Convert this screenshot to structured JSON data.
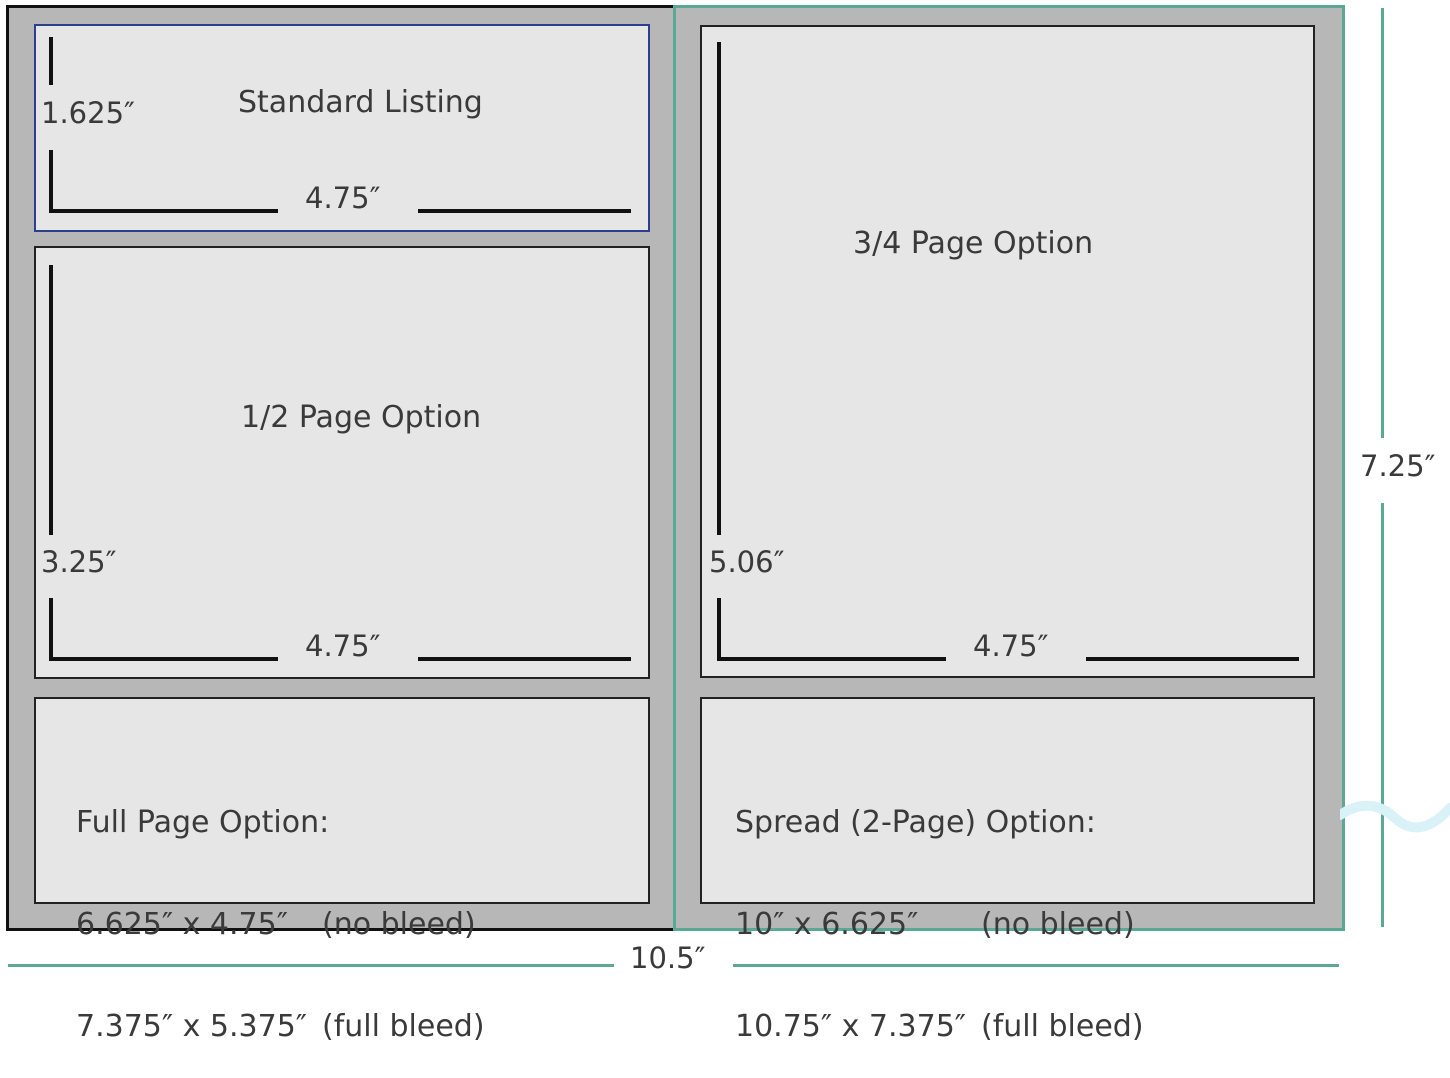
{
  "standard_listing": {
    "title": "Standard Listing",
    "height": "1.625″",
    "width": "4.75″"
  },
  "half_page": {
    "title": "1/2 Page Option",
    "height": "3.25″",
    "width": "4.75″"
  },
  "three_quarter_page": {
    "title": "3/4 Page Option",
    "height": "5.06″",
    "width": "4.75″"
  },
  "full_page": {
    "title": "Full Page Option:",
    "rows": [
      {
        "size": "6.625″ x 4.75″",
        "note": "(no bleed)"
      },
      {
        "size": "7.375″ x 5.375″",
        "note": "(full bleed)"
      }
    ]
  },
  "spread": {
    "title": "Spread (2-Page) Option:",
    "rows": [
      {
        "size": "10″ x 6.625″",
        "note": "(no bleed)"
      },
      {
        "size": "10.75″ x 7.375″",
        "note": "(full bleed)"
      }
    ]
  },
  "overall": {
    "height": "7.25″",
    "width": "10.5″"
  },
  "colors": {
    "page_bg": "#b7b7b7",
    "box_bg": "#e6e6e6",
    "teal": "#5aa995",
    "blue": "#2c3f8a"
  }
}
